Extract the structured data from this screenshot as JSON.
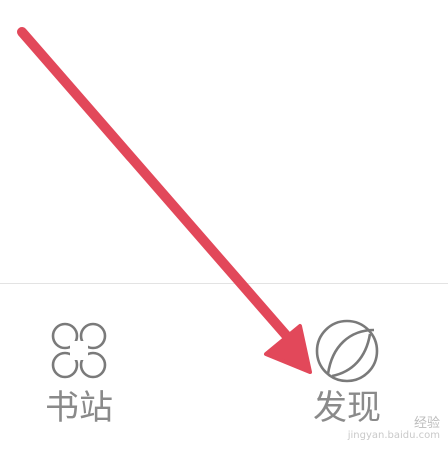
{
  "tabbar": {
    "tabs": [
      {
        "label": "书站",
        "icon": "bookstore-icon"
      },
      {
        "label": "发现",
        "icon": "discover-icon"
      }
    ]
  },
  "watermark": {
    "main": "经验",
    "sub": "jingyan.baidu.com"
  },
  "colors": {
    "arrow": "#e2485a",
    "tab_text": "#8a8a8a",
    "divider": "#e3e3e3",
    "background": "#ffffff"
  }
}
